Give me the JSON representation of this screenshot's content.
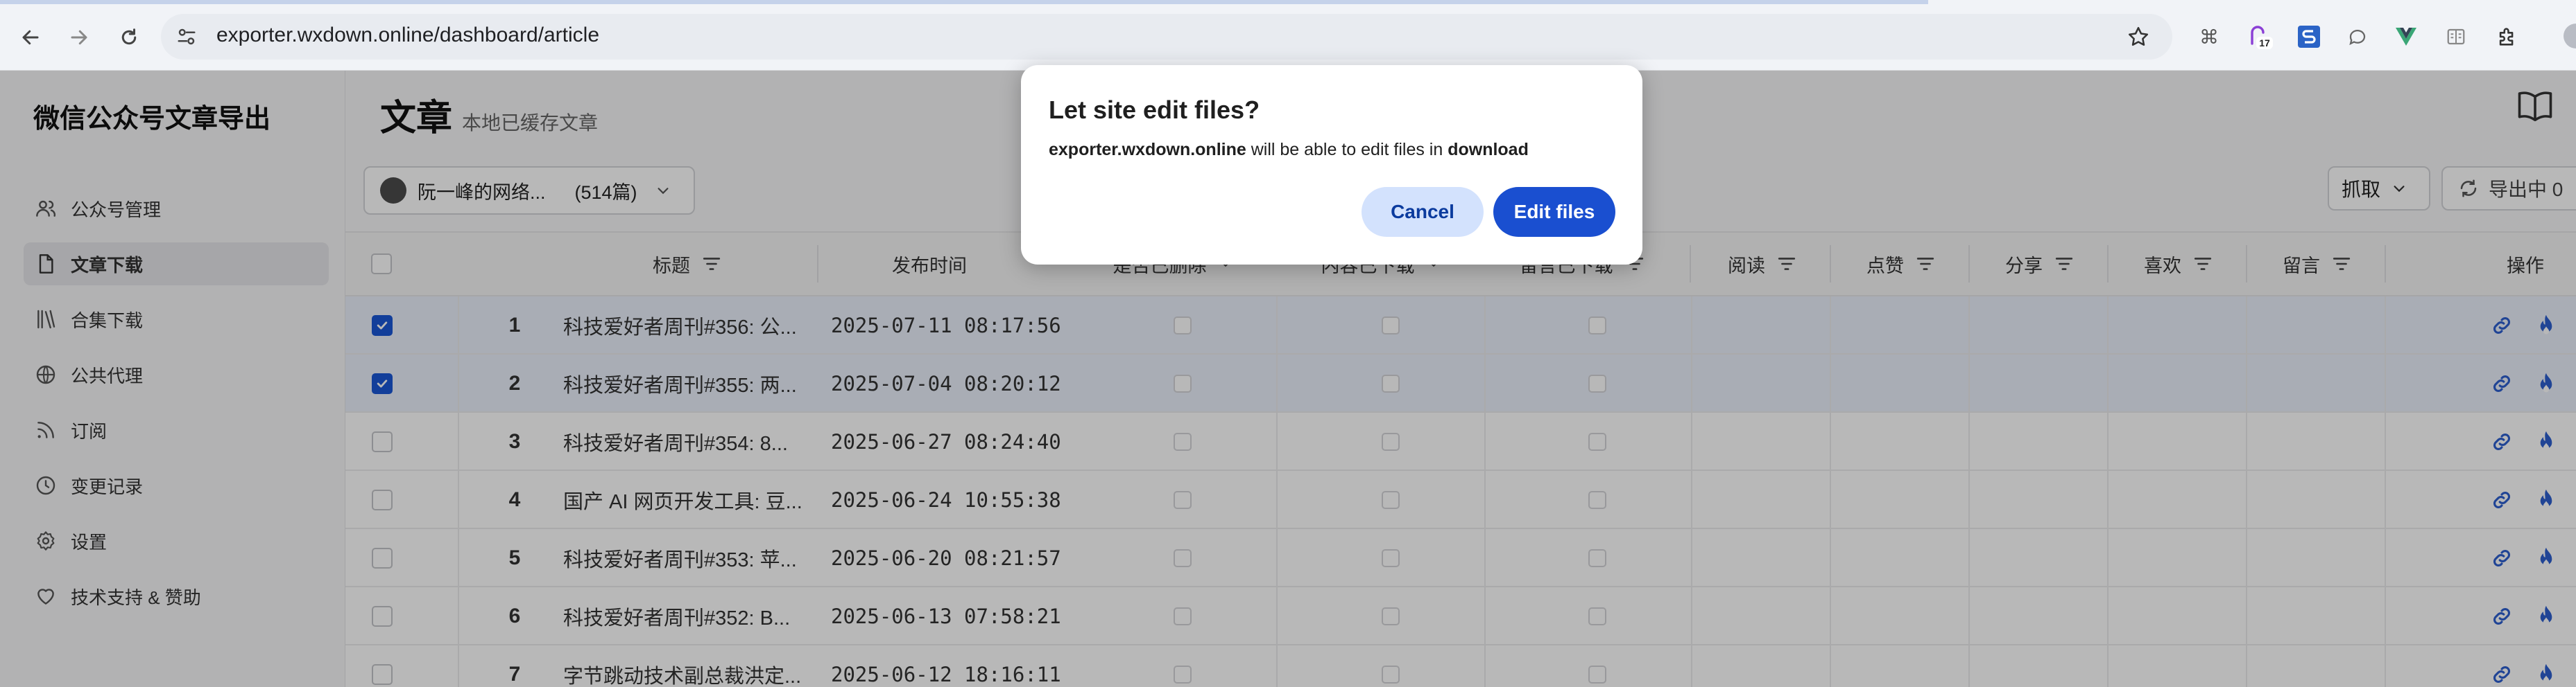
{
  "browser": {
    "url": "exporter.wxdown.online/dashboard/article",
    "extension_badge": "17"
  },
  "sidebar": {
    "app_title": "微信公众号文章导出",
    "items": [
      {
        "label": "公众号管理",
        "icon": "users-icon"
      },
      {
        "label": "文章下载",
        "icon": "document-icon",
        "active": true
      },
      {
        "label": "合集下载",
        "icon": "library-icon"
      },
      {
        "label": "公共代理",
        "icon": "globe-icon"
      },
      {
        "label": "订阅",
        "icon": "rss-icon"
      },
      {
        "label": "变更记录",
        "icon": "clock-icon"
      },
      {
        "label": "设置",
        "icon": "gear-icon"
      },
      {
        "label": "技术支持 & 赞助",
        "icon": "heart-icon"
      }
    ]
  },
  "header": {
    "title": "文章",
    "subtitle": "本地已缓存文章"
  },
  "toolbar": {
    "account_name": "阮一峰的网络...",
    "account_count": "(514篇)",
    "grab_label": "抓取",
    "export_label": "导出中 0"
  },
  "table": {
    "columns": {
      "title": "标题",
      "date": "发布时间",
      "deleted": "是否已删除",
      "content_downloaded": "内容已下载",
      "comments_downloaded": "留言已下载",
      "reads": "阅读",
      "likes": "点赞",
      "shares": "分享",
      "favorites": "喜欢",
      "comments": "留言",
      "actions": "操作"
    },
    "rows": [
      {
        "index": "1",
        "title": "科技爱好者周刊#356: 公...",
        "date": "2025-07-11 08:17:56",
        "selected": true
      },
      {
        "index": "2",
        "title": "科技爱好者周刊#355: 两...",
        "date": "2025-07-04 08:20:12",
        "selected": true
      },
      {
        "index": "3",
        "title": "科技爱好者周刊#354: 8...",
        "date": "2025-06-27 08:24:40",
        "selected": false
      },
      {
        "index": "4",
        "title": "国产 AI 网页开发工具: 豆...",
        "date": "2025-06-24 10:55:38",
        "selected": false
      },
      {
        "index": "5",
        "title": "科技爱好者周刊#353: 苹...",
        "date": "2025-06-20 08:21:57",
        "selected": false
      },
      {
        "index": "6",
        "title": "科技爱好者周刊#352: B...",
        "date": "2025-06-13 07:58:21",
        "selected": false
      },
      {
        "index": "7",
        "title": "字节跳动技术副总裁洪定...",
        "date": "2025-06-12 18:16:11",
        "selected": false
      }
    ]
  },
  "dialog": {
    "title": "Let site edit files?",
    "site": "exporter.wxdown.online",
    "message_mid": " will be able to edit files in ",
    "folder": "download",
    "cancel_label": "Cancel",
    "confirm_label": "Edit files"
  },
  "colors": {
    "accent": "#1a4fd0",
    "selected_row": "#eaf0fb"
  }
}
